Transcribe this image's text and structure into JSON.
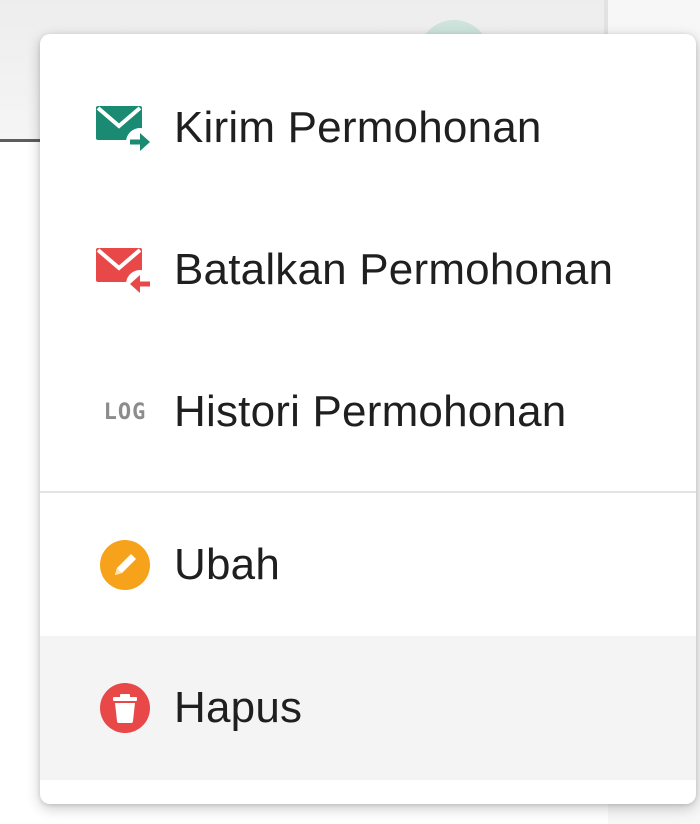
{
  "menu": {
    "items": [
      {
        "label": "Kirim Permohonan",
        "icon": "send-mail-icon",
        "color": "#1a8a72"
      },
      {
        "label": "Batalkan Permohonan",
        "icon": "cancel-mail-icon",
        "color": "#e84848"
      },
      {
        "label": "Histori Permohonan",
        "icon": "log-icon",
        "icon_text": "LOG",
        "color": "#8c8c8c"
      },
      {
        "label": "Ubah",
        "icon": "edit-pencil-icon",
        "color": "#f7a21b"
      },
      {
        "label": "Hapus",
        "icon": "delete-trash-icon",
        "color": "#e84848"
      }
    ],
    "hovered_item": "Hapus"
  }
}
